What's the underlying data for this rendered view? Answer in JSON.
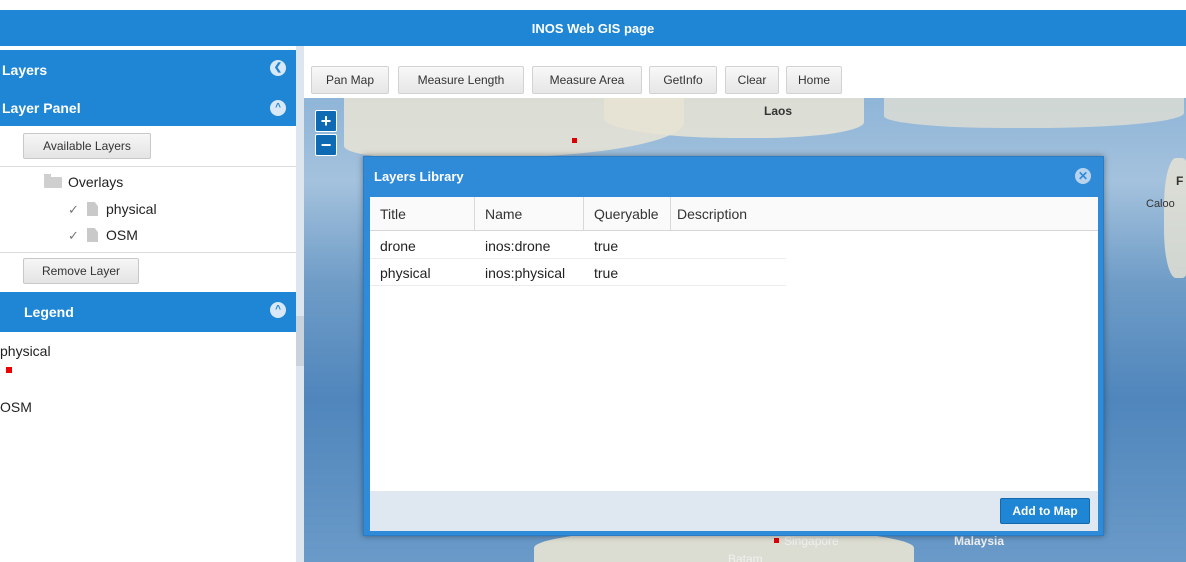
{
  "header": {
    "title": "INOS Web GIS page"
  },
  "sidebar": {
    "layers_title": "Layers",
    "layer_panel_title": "Layer Panel",
    "available_layers_label": "Available Layers",
    "tree": {
      "folder_label": "Overlays",
      "items": [
        {
          "label": "physical",
          "checked": true
        },
        {
          "label": "OSM",
          "checked": true
        }
      ]
    },
    "remove_layer_label": "Remove Layer",
    "legend_title": "Legend",
    "legend_items": [
      {
        "label": "physical",
        "swatch_color": "#e00000"
      },
      {
        "label": "OSM"
      }
    ]
  },
  "toolbar": {
    "buttons": [
      "Pan Map",
      "Measure Length",
      "Measure Area",
      "GetInfo",
      "Clear",
      "Home"
    ]
  },
  "map": {
    "zoom_in": "+",
    "zoom_out": "−",
    "labels": [
      "Laos",
      "Caloo",
      "Singapore",
      "Batam",
      "Malaysia",
      "F"
    ]
  },
  "dialog": {
    "title": "Layers Library",
    "columns": [
      "Title",
      "Name",
      "Queryable",
      "Description"
    ],
    "rows": [
      {
        "title": "drone",
        "name": "inos:drone",
        "queryable": "true",
        "description": ""
      },
      {
        "title": "physical",
        "name": "inos:physical",
        "queryable": "true",
        "description": ""
      }
    ],
    "add_button_label": "Add to Map"
  },
  "colors": {
    "accent": "#1e86d4",
    "dialog": "#2f8ad8"
  },
  "icons": {
    "collapse": "chevron-left-icon",
    "expand": "chevron-up-icon",
    "close": "close-icon"
  }
}
